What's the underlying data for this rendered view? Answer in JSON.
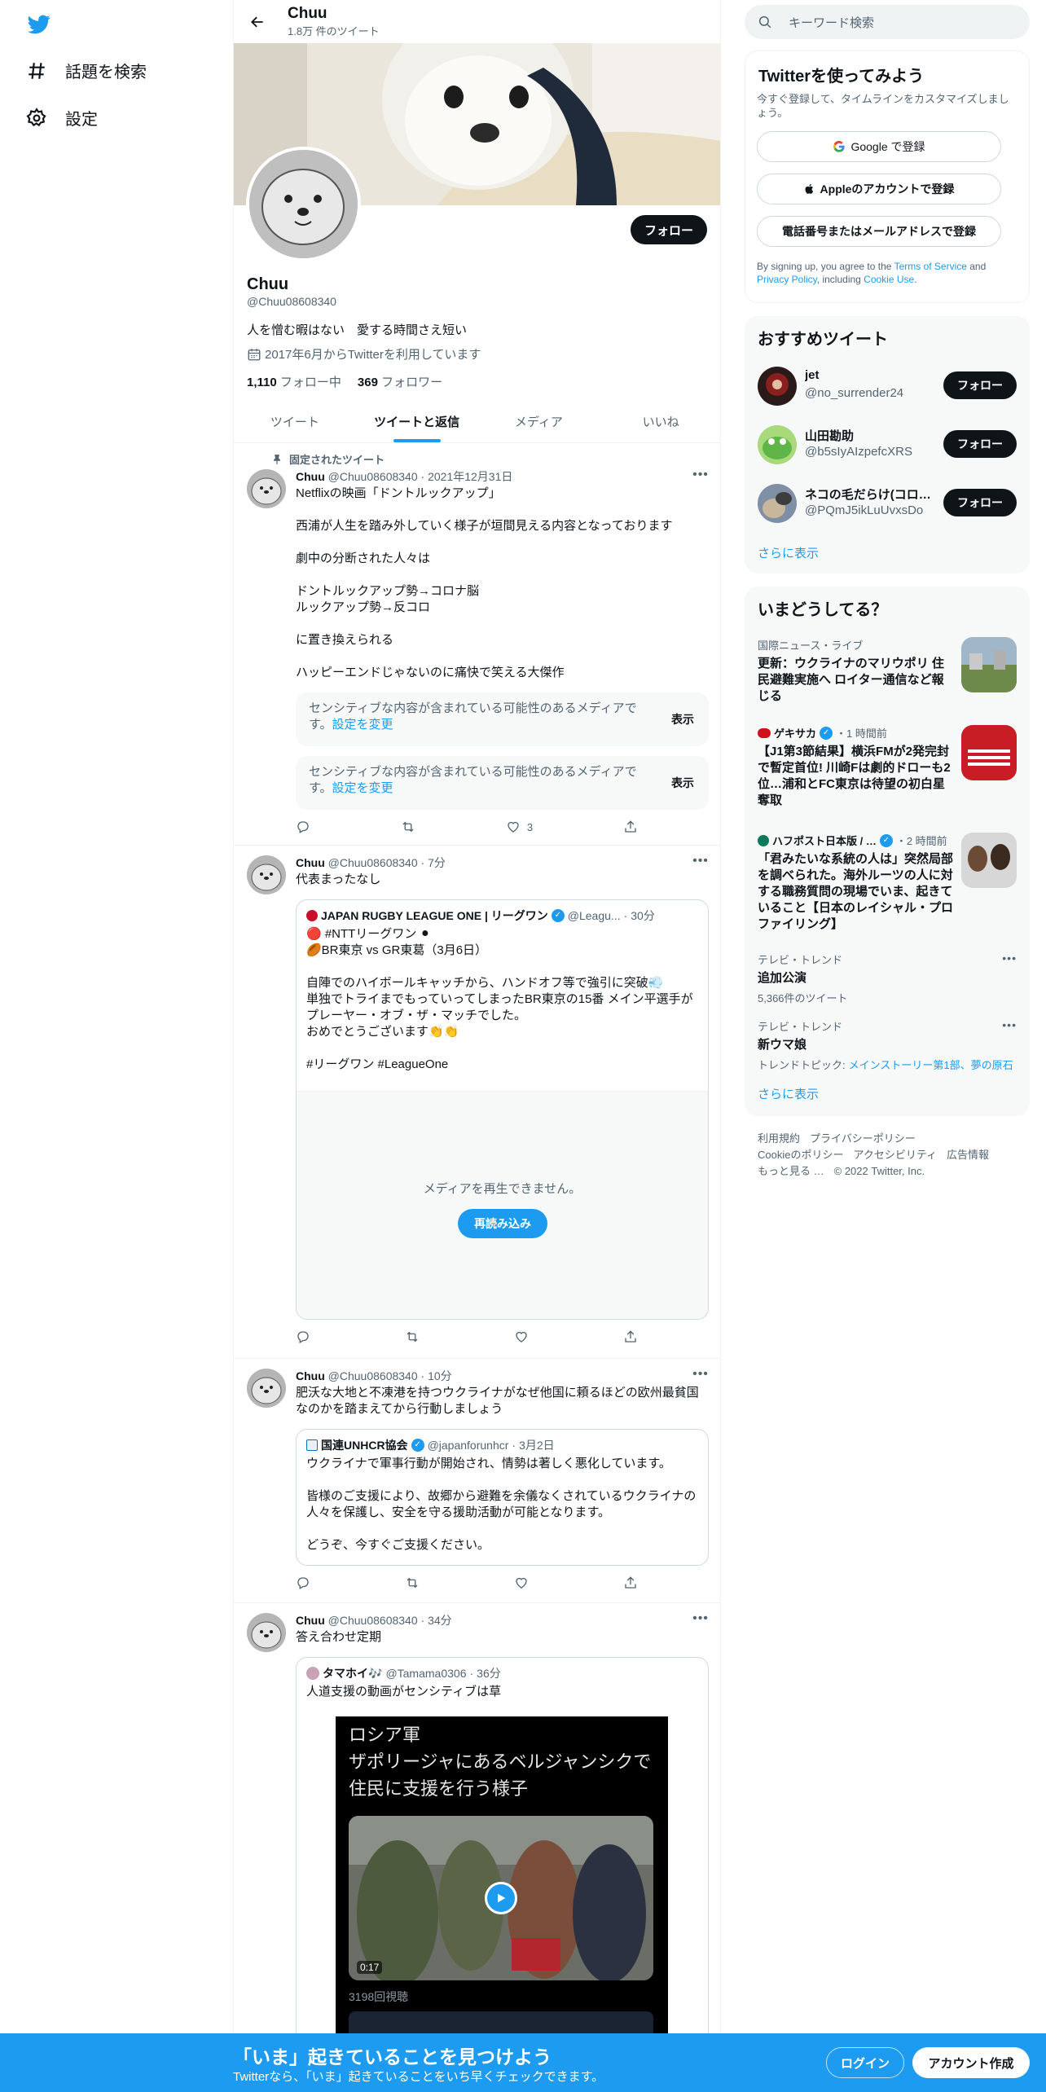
{
  "nav": {
    "logo": "twitter-bird-icon",
    "items": [
      {
        "label": "話題を検索",
        "icon": "hashtag-icon"
      },
      {
        "label": "設定",
        "icon": "gear-icon"
      }
    ]
  },
  "profile": {
    "header_name": "Chuu",
    "tweet_count": "1.8万 件のツイート",
    "name": "Chuu",
    "handle": "@Chuu08608340",
    "bio": "人を憎む暇はない　愛する時間さえ短い",
    "joined": "2017年6月からTwitterを利用しています",
    "following_count": "1,110",
    "following_label": "フォロー中",
    "followers_count": "369",
    "followers_label": "フォロワー",
    "follow_label": "フォロー"
  },
  "tabs": [
    "ツイート",
    "ツイートと返信",
    "メディア",
    "いいね"
  ],
  "tweets": [
    {
      "pinned_label": "固定されたツイート",
      "name": "Chuu",
      "handle": "@Chuu08608340",
      "time": "2021年12月31日",
      "text": "Netflixの映画「ドントルックアップ」\n\n西浦が人生を踏み外していく様子が垣間見える内容となっております\n\n劇中の分断された人々は\n\nドントルックアップ勢→コロナ脳\nルックアップ勢→反コロ\n\nに置き換えられる\n\nハッピーエンドじゃないのに痛快で笑える大傑作",
      "sensitive": [
        {
          "msg": "センシティブな内容が含まれている可能性のあるメディアです。",
          "link": "設定を変更",
          "show": "表示"
        },
        {
          "msg": "センシティブな内容が含まれている可能性のあるメディアです。",
          "link": "設定を変更",
          "show": "表示"
        }
      ],
      "likes": "3"
    },
    {
      "name": "Chuu",
      "handle": "@Chuu08608340",
      "time": "7分",
      "text": "代表まったなし",
      "quote": {
        "name": "JAPAN RUGBY LEAGUE ONE | リーグワン",
        "handle": "@Leagu...",
        "time": "30分",
        "text": "🔴 #NTTリーグワン ⚫\n🏉BR東京 vs GR東葛（3月6日）\n\n自陣でのハイボールキャッチから、ハンドオフ等で強引に突破💨\n単独でトライまでもっていってしまったBR東京の15番 メイン平選手がプレーヤー・オブ・ザ・マッチでした。\nおめでとうございます👏👏\n\n#リーグワン #LeagueOne",
        "media_error": "メディアを再生できません。",
        "reload": "再読み込み"
      }
    },
    {
      "name": "Chuu",
      "handle": "@Chuu08608340",
      "time": "10分",
      "text": "肥沃な大地と不凍港を持つウクライナがなぜ他国に頼るほどの欧州最貧国なのかを踏まえてから行動しましょう",
      "quote": {
        "name": "国連UNHCR協会",
        "handle": "@japanforunhcr",
        "time": "3月2日",
        "text": "ウクライナで軍事行動が開始され、情勢は著しく悪化しています。\n\n皆様のご支援により、故郷から避難を余儀なくされているウクライナの人々を保護し、安全を守る援助活動が可能となります。\n\nどうぞ、今すぐご支援ください。"
      }
    },
    {
      "name": "Chuu",
      "handle": "@Chuu08608340",
      "time": "34分",
      "text": "答え合わせ定期",
      "quote": {
        "name": "タマホイ🎶",
        "handle": "@Tamama0306",
        "time": "36分",
        "text": "人道支援の動画がセンシティブは草",
        "video_caption_1": "ロシア軍",
        "video_caption_2": "ザポリージャにあるベルジャンシクで",
        "video_caption_3": "住民に支援を行う様子",
        "duration": "0:17",
        "views": "3198回視聴"
      }
    }
  ],
  "right": {
    "search_placeholder": "キーワード検索",
    "signup": {
      "title": "Twitterを使ってみよう",
      "subtitle": "今すぐ登録して、タイムラインをカスタマイズしましょう。",
      "google": "Google で登録",
      "apple": "Appleのアカウントで登録",
      "phone": "電話番号またはメールアドレスで登録",
      "terms_prefix": "By signing up, you agree to the ",
      "terms": "Terms of Service",
      "and": " and ",
      "privacy": "Privacy Policy",
      "including": ", including ",
      "cookie": "Cookie Use",
      "period": "."
    },
    "recommend": {
      "title": "おすすめツイート",
      "users": [
        {
          "name": "jet",
          "handle": "@no_surrender24"
        },
        {
          "name": "山田勘助",
          "handle": "@b5sIyAIzpefcXRS"
        },
        {
          "name": "ネコの毛だらけ(コロ…",
          "handle": "@PQmJ5ikLuUvxsDo"
        }
      ],
      "follow": "フォロー",
      "more": "さらに表示"
    },
    "trends": {
      "title": "いまどうしてる？",
      "items": [
        {
          "meta": "国際ニュース・ライブ",
          "title": "更新：ウクライナのマリウポリ 住民避難実施へ ロイター通信など報じる"
        },
        {
          "meta_source": "ゲキサカ",
          "meta_time": "・1 時間前",
          "title": "【J1第3節結果】横浜FMが2発完封で暫定首位! 川崎Fは劇的ドローも2位…浦和とFC東京は待望の初白星奪取"
        },
        {
          "meta_source": "ハフポスト日本版 / …",
          "meta_time": "・2 時間前",
          "title": "「君みたいな系統の人は」突然局部を調べられた。海外ルーツの人に対する職務質問の現場でいま、起きていること【日本のレイシャル・プロファイリング】"
        },
        {
          "meta": "テレビ・トレンド",
          "title": "追加公演",
          "sub": "5,366件のツイート"
        },
        {
          "meta": "テレビ・トレンド",
          "title": "新ウマ娘",
          "sub_prefix": "トレンドトピック: ",
          "sub_link": "メインストーリー第1部、夢の原石"
        }
      ],
      "more": "さらに表示"
    },
    "footer": [
      "利用規約",
      "プライバシーポリシー",
      "Cookieのポリシー",
      "アクセシビリティ",
      "広告情報",
      "もっと見る …",
      "© 2022 Twitter, Inc."
    ]
  },
  "bottom": {
    "title": "「いま」起きていることを見つけよう",
    "subtitle": "Twitterなら、「いま」起きていることをいち早くチェックできます。",
    "login": "ログイン",
    "signup": "アカウント作成"
  }
}
